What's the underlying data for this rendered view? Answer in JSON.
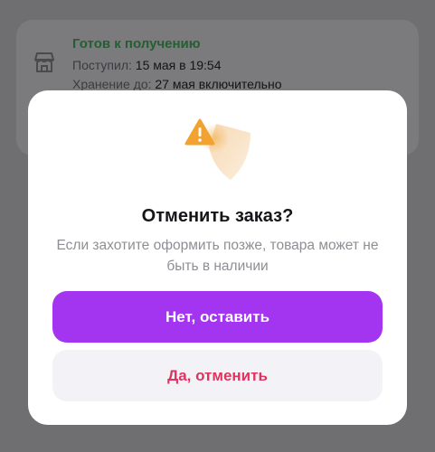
{
  "order": {
    "status": "Готов к получению",
    "received_label": "Поступил:",
    "received_value": "15 мая в 19:54",
    "storage_label": "Хранение до:",
    "storage_value": "27 мая включительно"
  },
  "dialog": {
    "title": "Отменить заказ?",
    "description": "Если захотите оформить позже, товара может не быть в наличии",
    "keep_button": "Нет, оставить",
    "cancel_button": "Да, отменить"
  },
  "colors": {
    "accent": "#a334f0",
    "danger": "#e0335f",
    "status_green": "#255e32"
  },
  "icons": {
    "store": "store-icon",
    "illustration": "warning-shield-icon"
  }
}
